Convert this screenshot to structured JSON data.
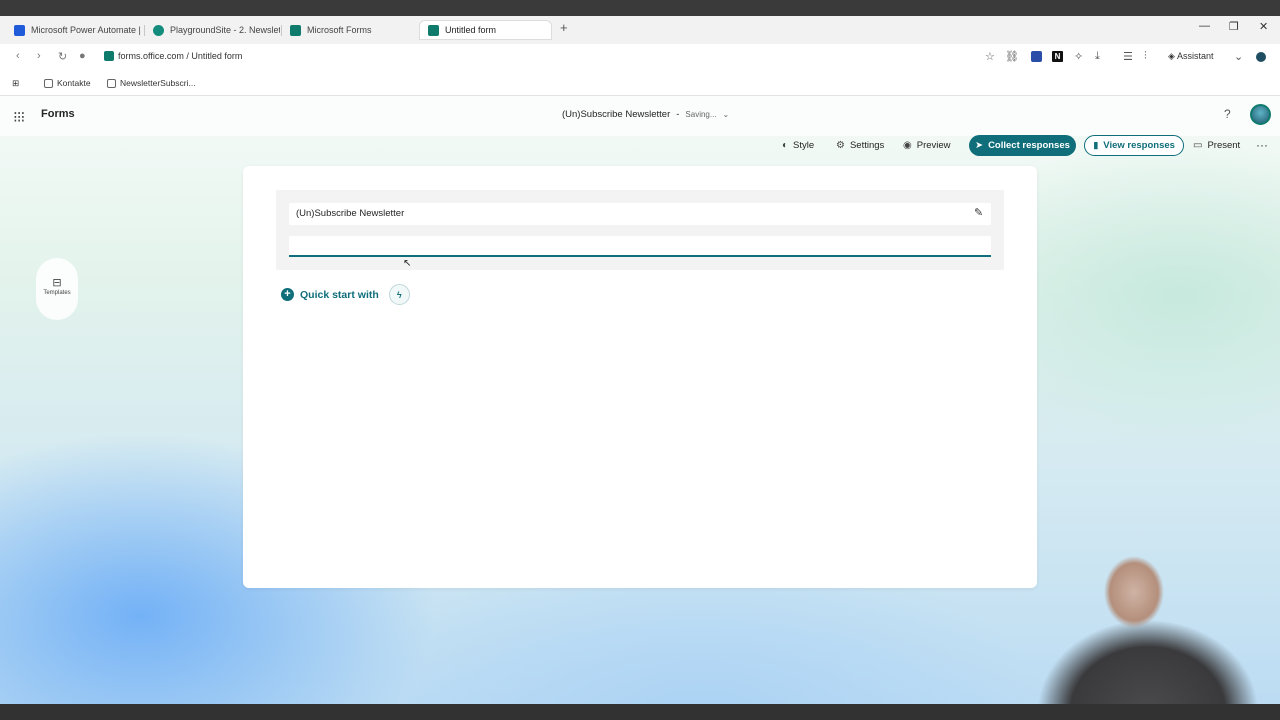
{
  "browser": {
    "tabs": [
      {
        "label": "Microsoft Power Automate | P",
        "active": false
      },
      {
        "label": "PlaygroundSite - 2. Newslette",
        "active": false
      },
      {
        "label": "Microsoft Forms",
        "active": false
      },
      {
        "label": "Untitled form",
        "active": true
      }
    ],
    "new_tab_symbol": "+",
    "url": "forms.office.com / Untitled form",
    "assistant_label": "Assistant",
    "extension_letter": "N",
    "bookmarks": [
      {
        "label": "Kontakte"
      },
      {
        "label": "NewsletterSubscri..."
      }
    ]
  },
  "forms_header": {
    "brand": "Forms",
    "form_title": "(Un)Subscribe Newsletter",
    "separator": "-",
    "status": "Saving...",
    "help_symbol": "?"
  },
  "commands": {
    "style": "Style",
    "settings": "Settings",
    "preview": "Preview",
    "collect": "Collect responses",
    "view": "View responses",
    "present": "Present",
    "more": "···"
  },
  "sidebar": {
    "templates_label": "Templates"
  },
  "form": {
    "title_value": "(Un)Subscribe Newsletter",
    "description_value": "",
    "quick_start_label": "Quick start with"
  },
  "colors": {
    "accent": "#0f6e7a",
    "brand_green": "#0f7b6c"
  }
}
